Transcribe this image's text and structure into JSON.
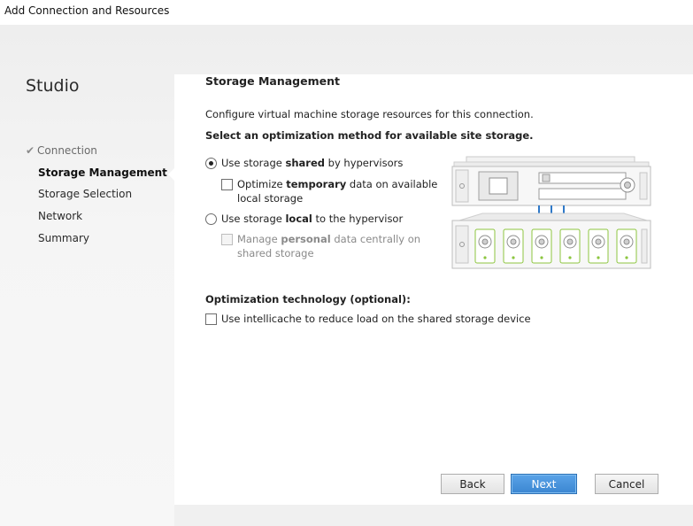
{
  "window": {
    "title": "Add Connection and Resources"
  },
  "sidebar": {
    "brand": "Studio",
    "steps": [
      {
        "label": "Connection",
        "state": "done"
      },
      {
        "label": "Storage Management",
        "state": "current"
      },
      {
        "label": "Storage Selection",
        "state": "pending"
      },
      {
        "label": "Network",
        "state": "pending"
      },
      {
        "label": "Summary",
        "state": "pending"
      }
    ]
  },
  "main": {
    "title": "Storage Management",
    "description": "Configure virtual machine storage resources for this connection.",
    "select_prompt": "Select an optimization method for available site storage.",
    "option_shared": {
      "pre": "Use storage ",
      "bold": "shared",
      "post": " by hypervisors",
      "selected": true
    },
    "option_temp": {
      "pre": "Optimize ",
      "bold": "temporary",
      "line1_post": " data on available",
      "line2": "local storage",
      "checked": false
    },
    "option_local": {
      "pre": "Use storage ",
      "bold": "local",
      "post": " to the hypervisor",
      "selected": false
    },
    "option_personal": {
      "pre": "Manage ",
      "bold": "personal",
      "line1_post": " data centrally on",
      "line2": "shared storage",
      "checked": false,
      "disabled": true
    },
    "optimization_heading": "Optimization technology (optional):",
    "intellicache_label": "Use intellicache to reduce load on the shared storage device",
    "intellicache_checked": false
  },
  "footer": {
    "back": "Back",
    "next": "Next",
    "cancel": "Cancel"
  },
  "colors": {
    "primary_button": "#3b86d1",
    "disk_accent": "#8cc63f",
    "link_blue": "#2f79c8"
  }
}
